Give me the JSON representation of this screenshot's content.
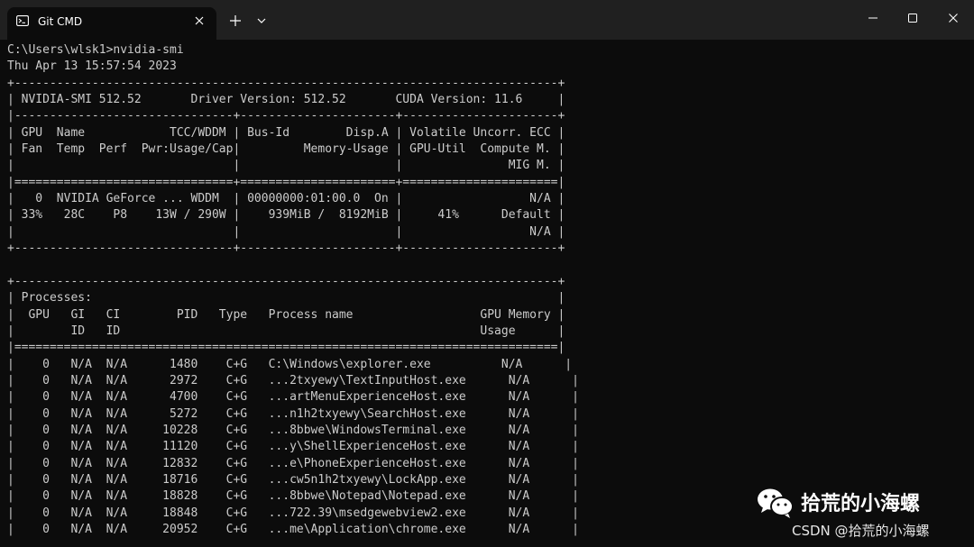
{
  "window": {
    "tab_title": "Git CMD",
    "icons": {
      "tab": "terminal-icon",
      "tab_close": "close-icon",
      "new_tab": "plus-icon",
      "dropdown": "chevron-down-icon",
      "minimize": "minimize-icon",
      "maximize": "maximize-icon",
      "close": "close-icon"
    },
    "colors": {
      "titlebar": "#202020",
      "console_background": "#0c0c0c",
      "console_text": "#cccccc"
    }
  },
  "console": {
    "lines": [
      "C:\\Users\\wlsk1>nvidia-smi",
      "Thu Apr 13 15:57:54 2023",
      "+-----------------------------------------------------------------------------+",
      "| NVIDIA-SMI 512.52       Driver Version: 512.52       CUDA Version: 11.6     |",
      "|-------------------------------+----------------------+----------------------+",
      "| GPU  Name            TCC/WDDM | Bus-Id        Disp.A | Volatile Uncorr. ECC |",
      "| Fan  Temp  Perf  Pwr:Usage/Cap|         Memory-Usage | GPU-Util  Compute M. |",
      "|                               |                      |               MIG M. |",
      "|===============================+======================+======================|",
      "|   0  NVIDIA GeForce ... WDDM  | 00000000:01:00.0  On |                  N/A |",
      "| 33%   28C    P8    13W / 290W |    939MiB /  8192MiB |     41%      Default |",
      "|                               |                      |                  N/A |",
      "+-------------------------------+----------------------+----------------------+",
      "",
      "+-----------------------------------------------------------------------------+",
      "| Processes:                                                                  |",
      "|  GPU   GI   CI        PID   Type   Process name                  GPU Memory |",
      "|        ID   ID                                                   Usage      |",
      "|=============================================================================|",
      "|    0   N/A  N/A      1480    C+G   C:\\Windows\\explorer.exe          N/A      |",
      "|    0   N/A  N/A      2972    C+G   ...2txyewy\\TextInputHost.exe      N/A      |",
      "|    0   N/A  N/A      4700    C+G   ...artMenuExperienceHost.exe      N/A      |",
      "|    0   N/A  N/A      5272    C+G   ...n1h2txyewy\\SearchHost.exe      N/A      |",
      "|    0   N/A  N/A     10228    C+G   ...8bbwe\\WindowsTerminal.exe      N/A      |",
      "|    0   N/A  N/A     11120    C+G   ...y\\ShellExperienceHost.exe      N/A      |",
      "|    0   N/A  N/A     12832    C+G   ...e\\PhoneExperienceHost.exe      N/A      |",
      "|    0   N/A  N/A     18716    C+G   ...cw5n1h2txyewy\\LockApp.exe      N/A      |",
      "|    0   N/A  N/A     18828    C+G   ...8bbwe\\Notepad\\Notepad.exe      N/A      |",
      "|    0   N/A  N/A     18848    C+G   ...722.39\\msedgewebview2.exe      N/A      |",
      "|    0   N/A  N/A     20952    C+G   ...me\\Application\\chrome.exe      N/A      |"
    ]
  },
  "watermark": {
    "logo_icon": "wechat-icon",
    "name": "拾荒的小海螺",
    "sub": "CSDN @拾荒的小海螺"
  }
}
